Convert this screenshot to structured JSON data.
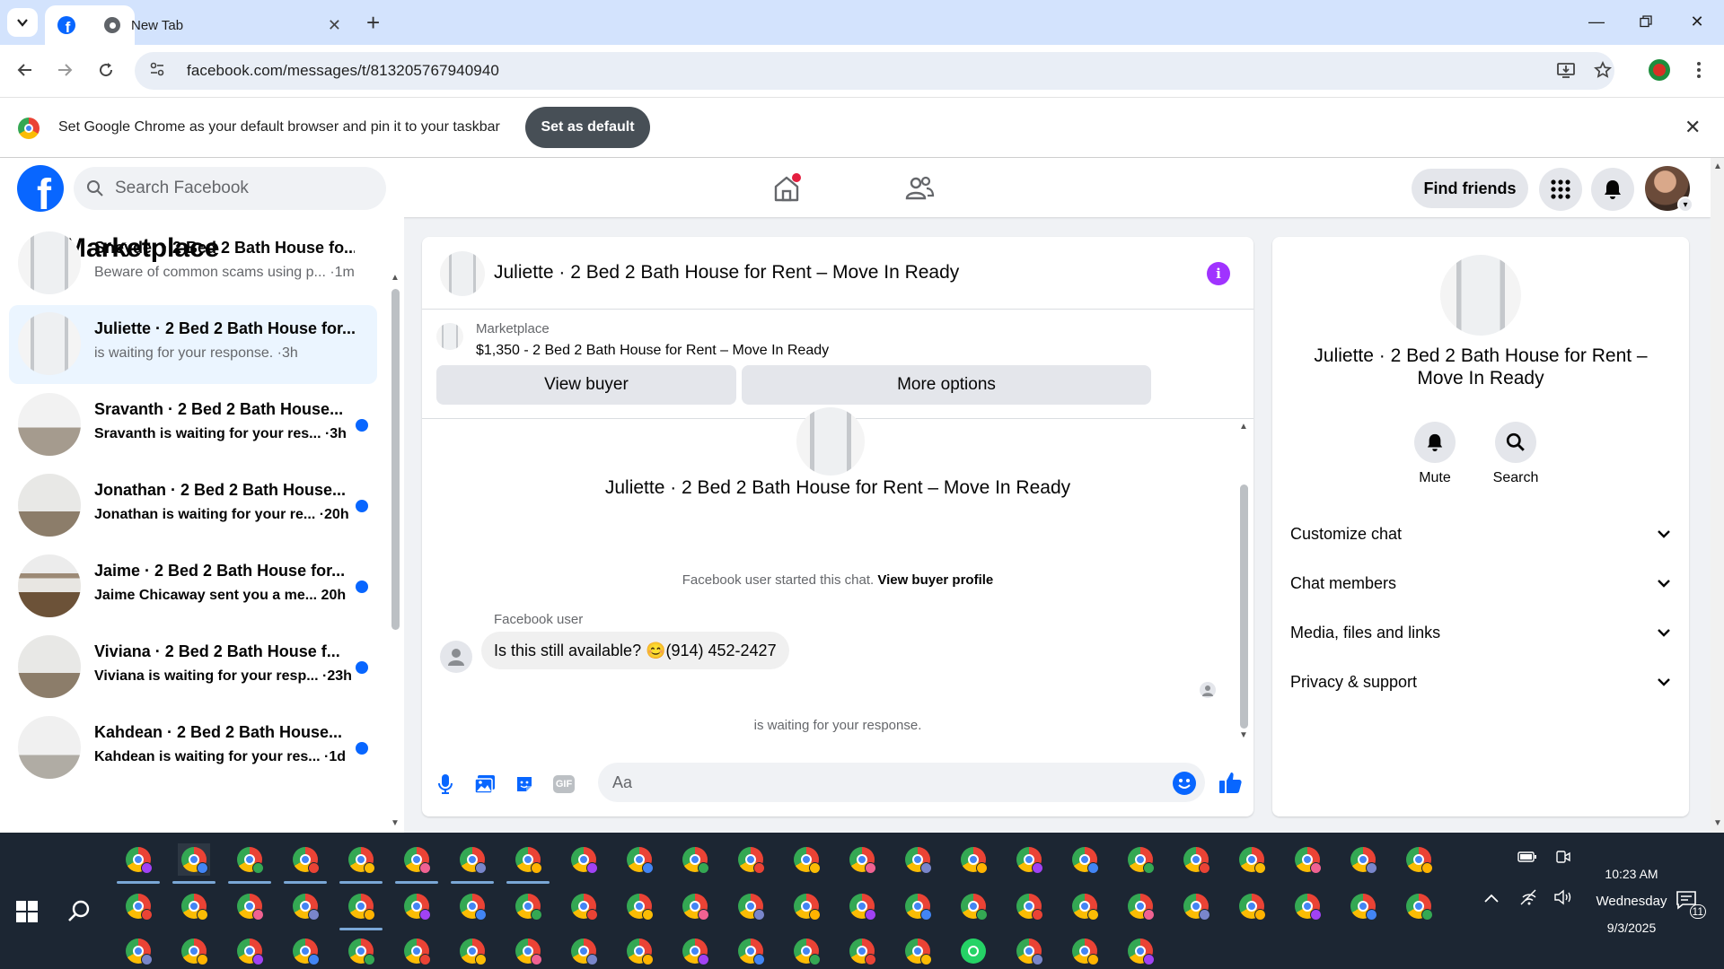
{
  "browser": {
    "tabs": [
      {
        "title": "",
        "icon": "facebook-icon",
        "active": true
      },
      {
        "title": "New Tab",
        "icon": "chrome-icon",
        "active": false
      }
    ],
    "url": "facebook.com/messages/t/813205767940940",
    "infobar": {
      "message": "Set Google Chrome as your default browser and pin it to your taskbar",
      "button": "Set as default"
    }
  },
  "header": {
    "search_placeholder": "Search Facebook",
    "find_friends": "Find friends"
  },
  "left": {
    "title": "Marketplace",
    "conversations": [
      {
        "name": "Sneyder · 2 Bed 2 Bath House fo...",
        "preview": "Beware of common scams using p... ·1m",
        "unread": false,
        "selected": false,
        "thumb": "room1"
      },
      {
        "name": "Juliette · 2 Bed 2 Bath House for...",
        "preview": "is waiting for your response. ·3h",
        "unread": false,
        "selected": true,
        "thumb": "room1"
      },
      {
        "name": "Sravanth · 2 Bed 2 Bath House...",
        "preview": "Sravanth is waiting for your res... ·3h",
        "unread": true,
        "selected": false,
        "thumb": "room2"
      },
      {
        "name": "Jonathan · 2 Bed 2 Bath House...",
        "preview": "Jonathan is waiting for your re... ·20h",
        "unread": true,
        "selected": false,
        "thumb": "room4"
      },
      {
        "name": "Jaime · 2 Bed 2 Bath House for...",
        "preview": "Jaime Chicaway sent you a me... 20h",
        "unread": true,
        "selected": false,
        "thumb": "room3"
      },
      {
        "name": "Viviana · 2 Bed 2 Bath House f...",
        "preview": "Viviana is waiting for your resp... ·23h",
        "unread": true,
        "selected": false,
        "thumb": "room4"
      },
      {
        "name": "Kahdean · 2 Bed 2 Bath House...",
        "preview": "Kahdean is waiting for your res... ·1d",
        "unread": true,
        "selected": false,
        "thumb": "room5"
      }
    ]
  },
  "chat": {
    "title": "Juliette · 2 Bed 2 Bath House for Rent – Move In Ready",
    "marketplace_label": "Marketplace",
    "listing": "$1,350 - 2 Bed 2 Bath House for Rent – Move In Ready",
    "view_buyer": "View buyer",
    "more_options": "More options",
    "started_text": "Facebook user started this chat.",
    "view_buyer_profile": "View buyer profile",
    "sender": "Facebook user",
    "message": "Is this still available? 😊(914) 452-2427",
    "waiting": "is waiting for your response.",
    "composer_placeholder": "Aa"
  },
  "right": {
    "name": "Juliette · 2 Bed 2 Bath House for Rent – Move In Ready",
    "mute": "Mute",
    "search": "Search",
    "sections": [
      "Customize chat",
      "Chat members",
      "Media, files and links",
      "Privacy & support"
    ]
  },
  "taskbar": {
    "time": "10:23 AM",
    "day": "Wednesday",
    "date": "9/3/2025",
    "notification_count": "11"
  },
  "colors": {
    "fb_blue": "#0866ff",
    "selected_bg": "#ebf5ff",
    "info_purple": "#a033ff",
    "chrome_tabstrip": "#d3e3fd"
  }
}
